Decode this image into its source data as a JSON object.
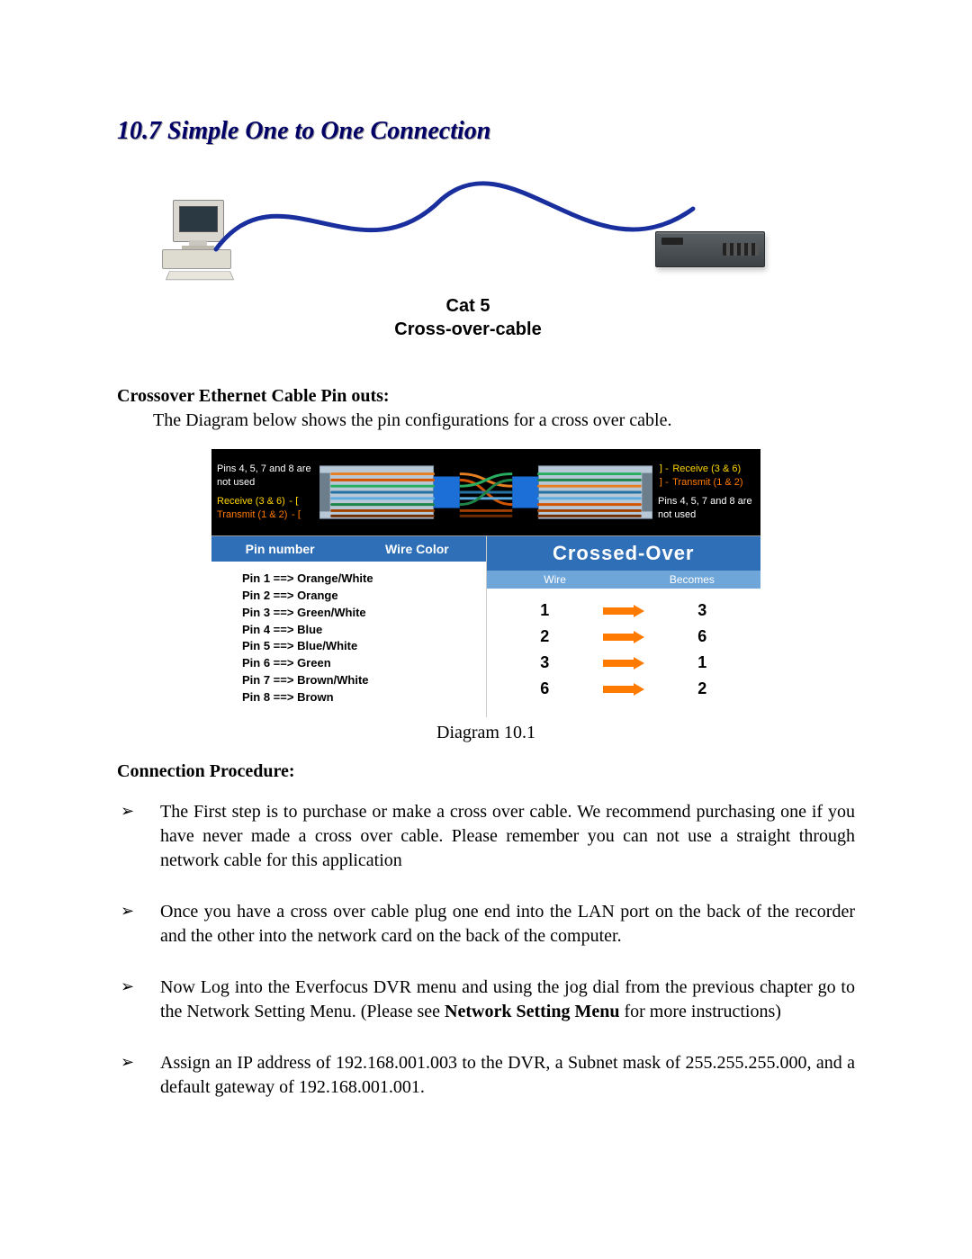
{
  "section_title": "10.7 Simple One to One Connection",
  "fig1": {
    "caption_line1": "Cat 5",
    "caption_line2": "Cross-over-cable"
  },
  "pinouts": {
    "heading": "Crossover Ethernet Cable Pin outs:",
    "intro": "The Diagram below shows the pin configurations for a cross over cable."
  },
  "diagram2": {
    "left_labels": {
      "not_used": "Pins 4, 5, 7 and 8 are not used",
      "receive": "Receive (3 & 6)",
      "transmit": "Transmit (1 & 2)"
    },
    "right_labels": {
      "receive": "Receive (3 & 6)",
      "transmit": "Transmit (1 & 2)",
      "not_used": "Pins 4, 5, 7 and 8 are not used"
    },
    "left_table": {
      "head_pin": "Pin number",
      "head_color": "Wire Color",
      "rows": [
        "Pin 1 ==> Orange/White",
        "Pin 2 ==> Orange",
        "Pin 3 ==> Green/White",
        "Pin 4 ==> Blue",
        "Pin 5 ==> Blue/White",
        "Pin 6 ==> Green",
        "Pin 7 ==> Brown/White",
        "Pin 8 ==> Brown"
      ]
    },
    "right_table": {
      "title": "Crossed-Over",
      "sub_wire": "Wire",
      "sub_becomes": "Becomes",
      "rows": [
        {
          "wire": "1",
          "becomes": "3"
        },
        {
          "wire": "2",
          "becomes": "6"
        },
        {
          "wire": "3",
          "becomes": "1"
        },
        {
          "wire": "6",
          "becomes": "2"
        }
      ]
    },
    "caption": "Diagram 10.1"
  },
  "procedure": {
    "heading": "Connection Procedure:",
    "items": [
      {
        "text": "The First step is to purchase or make a cross over cable. We recommend purchasing one if you have never made a cross over cable. Please remember you can not use a straight through network cable for this application"
      },
      {
        "text": "Once you have a cross over cable plug one end into the LAN port on the back of the recorder and the other into the network card on the back of the computer."
      },
      {
        "text_before": "Now Log into the Everfocus DVR menu and using the jog dial from the previous chapter go to the Network Setting Menu. (Please see ",
        "bold": "Network Setting Menu",
        "text_after": " for more instructions)"
      },
      {
        "text": "Assign an IP address of 192.168.001.003 to the DVR, a Subnet mask of 255.255.255.000, and a default gateway of 192.168.001.001."
      }
    ]
  }
}
